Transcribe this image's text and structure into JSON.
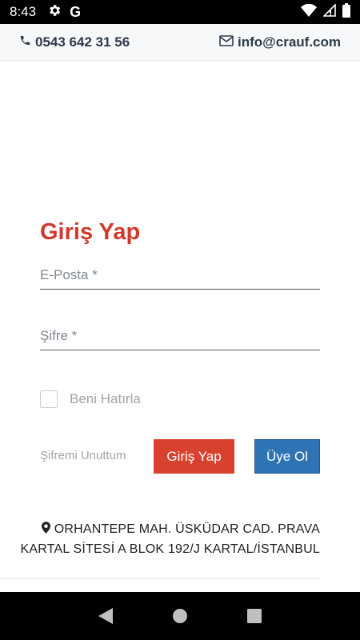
{
  "status_bar": {
    "time": "8:43",
    "icons": [
      "gear-icon",
      "google-icon",
      "wifi-icon",
      "signal-icon",
      "battery-icon"
    ],
    "google_glyph": "G"
  },
  "contact": {
    "phone": "0543 642 31 56",
    "email": "info@crauf.com"
  },
  "login": {
    "title": "Giriş Yap",
    "email_placeholder": "E-Posta *",
    "email_value": "",
    "password_placeholder": "Şifre *",
    "password_value": "",
    "remember_label": "Beni Hatırla",
    "remember_checked": false,
    "forgot_label": "Şifremi Unuttum",
    "login_button": "Giriş Yap",
    "register_button": "Üye Ol"
  },
  "address": {
    "line1": "ORHANTEPE MAH. ÜSKÜDAR CAD. PRAVA",
    "line2": "KARTAL SİTESİ A BLOK 192/J KARTAL/İSTANBUL"
  },
  "colors": {
    "accent_red": "#d9412f",
    "accent_blue": "#2e74b5",
    "title_red": "#d1392b",
    "text_dark": "#2d3a4a"
  },
  "nav": {
    "icons": [
      "back-icon",
      "home-icon",
      "recents-icon"
    ]
  }
}
